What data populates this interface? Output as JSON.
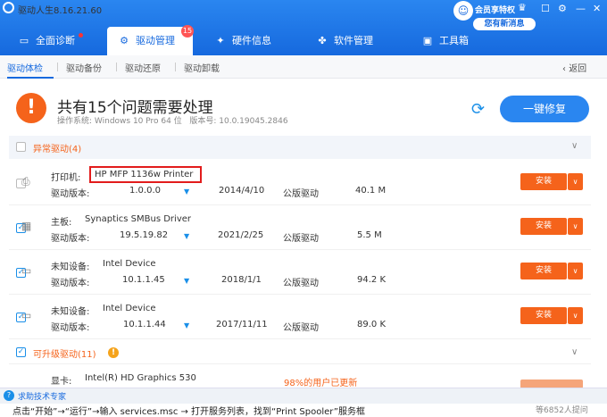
{
  "window": {
    "title": "驱动人生8.16.21.60",
    "member_label": "会员享特权",
    "message_badge": "您有新消息",
    "minimize": "—",
    "close": "✕",
    "settings": "⚙",
    "skin": "☐"
  },
  "nav": {
    "tabs": [
      {
        "label": "全面诊断",
        "icon": "▭"
      },
      {
        "label": "驱动管理",
        "icon": "⚙",
        "badge": "15"
      },
      {
        "label": "硬件信息",
        "icon": "✦"
      },
      {
        "label": "软件管理",
        "icon": "✤"
      },
      {
        "label": "工具箱",
        "icon": "▣"
      }
    ]
  },
  "subnav": {
    "tabs": [
      "驱动体检",
      "驱动备份",
      "驱动还原",
      "驱动卸载"
    ],
    "back": "返回"
  },
  "summary": {
    "headline": "共有15个问题需要处理",
    "os_label": "操作系统:",
    "os_value": "Windows 10 Pro 64 位",
    "ver_label": "版本号:",
    "ver_value": "10.0.19045.2846",
    "fix_button": "一键修复"
  },
  "abnormal": {
    "title": "异常驱动(4)"
  },
  "drivers": [
    {
      "type": "打印机:",
      "name": "HP MFP 1136w Printer",
      "ver_label": "驱动版本:",
      "version": "1.0.0.0",
      "date": "2014/4/10",
      "pub": "公版驱动",
      "size": "40.1 M",
      "checked": false,
      "install": "安装"
    },
    {
      "type": "主板:",
      "name": "Synaptics SMBus Driver",
      "ver_label": "驱动版本:",
      "version": "19.5.19.82",
      "date": "2021/2/25",
      "pub": "公版驱动",
      "size": "5.5 M",
      "checked": true,
      "install": "安装"
    },
    {
      "type": "未知设备:",
      "name": "Intel Device",
      "ver_label": "驱动版本:",
      "version": "10.1.1.45",
      "date": "2018/1/1",
      "pub": "公版驱动",
      "size": "94.2 K",
      "checked": true,
      "install": "安装"
    },
    {
      "type": "未知设备:",
      "name": "Intel Device",
      "ver_label": "驱动版本:",
      "version": "10.1.1.44",
      "date": "2017/11/11",
      "pub": "公版驱动",
      "size": "89.0 K",
      "checked": true,
      "install": "安装"
    }
  ],
  "upgradable": {
    "title": "可升级驱动(11)",
    "partial_type": "显卡:",
    "partial_name": "Intel(R) HD Graphics 530",
    "partial_note": "98%的用户已更新"
  },
  "footer": {
    "help": "求助技术专家",
    "bottom_left": "点击“开始”→“运行”→输入 services.msc → 打开服务列表，找到“Print Spooler”服务框",
    "bottom_right": "等6852人提问"
  }
}
